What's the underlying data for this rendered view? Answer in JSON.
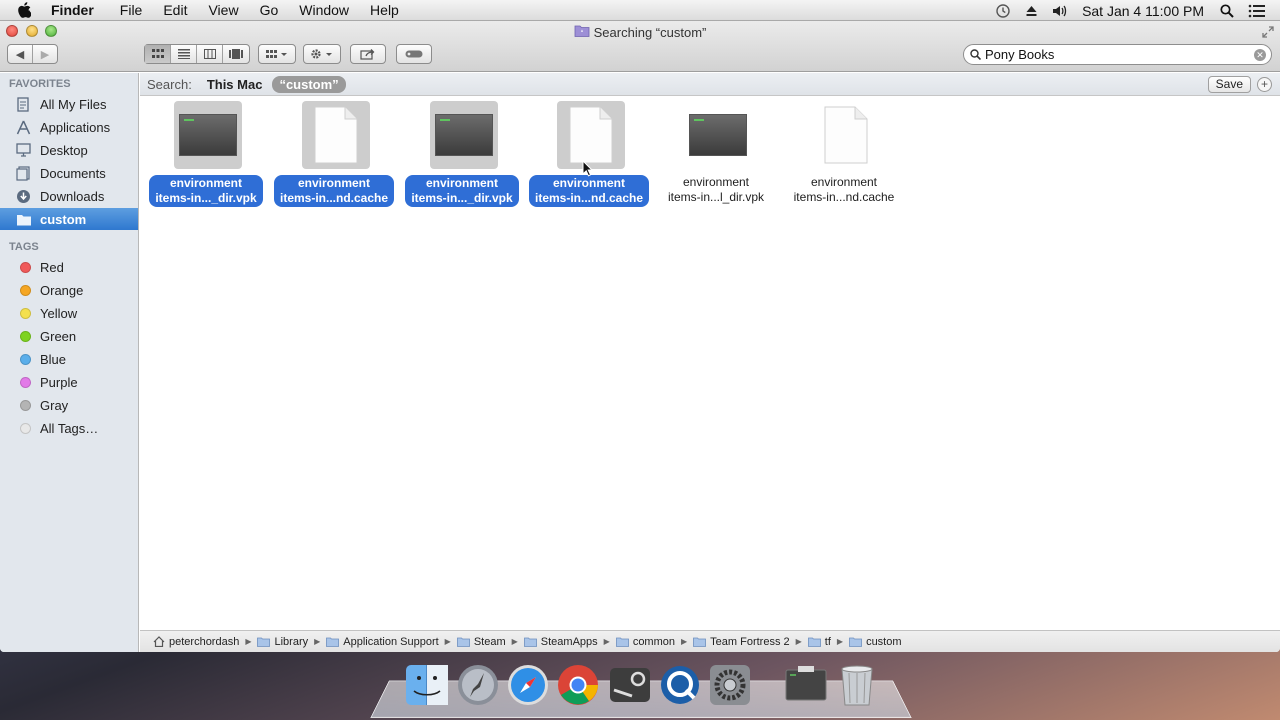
{
  "menubar": {
    "app_name": "Finder",
    "items": [
      "File",
      "Edit",
      "View",
      "Go",
      "Window",
      "Help"
    ],
    "clock": "Sat Jan 4  11:00 PM"
  },
  "window": {
    "title": "Searching “custom”",
    "search_value": "Pony Books"
  },
  "sidebar": {
    "favorites_header": "FAVORITES",
    "favorites": [
      {
        "label": "All My Files",
        "icon": "all-files-icon"
      },
      {
        "label": "Applications",
        "icon": "applications-icon"
      },
      {
        "label": "Desktop",
        "icon": "desktop-icon"
      },
      {
        "label": "Documents",
        "icon": "documents-icon"
      },
      {
        "label": "Downloads",
        "icon": "downloads-icon"
      },
      {
        "label": "custom",
        "icon": "folder-icon",
        "selected": true
      }
    ],
    "tags_header": "TAGS",
    "tags": [
      {
        "label": "Red",
        "color": "#f05a5a"
      },
      {
        "label": "Orange",
        "color": "#f5a623"
      },
      {
        "label": "Yellow",
        "color": "#f4e04d"
      },
      {
        "label": "Green",
        "color": "#7ed321"
      },
      {
        "label": "Blue",
        "color": "#5aaeea"
      },
      {
        "label": "Purple",
        "color": "#e27ae8"
      },
      {
        "label": "Gray",
        "color": "#b4b4b4"
      },
      {
        "label": "All Tags…",
        "color": "#e8e8e8"
      }
    ]
  },
  "scope": {
    "label": "Search:",
    "this_mac": "This Mac",
    "current": "“custom”",
    "save": "Save"
  },
  "files": [
    {
      "line1": "environment",
      "line2": "items-in..._dir.vpk",
      "kind": "terminal",
      "selected": true
    },
    {
      "line1": "environment",
      "line2": "items-in...nd.cache",
      "kind": "document",
      "selected": true
    },
    {
      "line1": "environment",
      "line2": "items-in..._dir.vpk",
      "kind": "terminal",
      "selected": true
    },
    {
      "line1": "environment",
      "line2": "items-in...nd.cache",
      "kind": "document",
      "selected": true
    },
    {
      "line1": "environment",
      "line2": "items-in...l_dir.vpk",
      "kind": "terminal",
      "selected": false
    },
    {
      "line1": "environment",
      "line2": "items-in...nd.cache",
      "kind": "document",
      "selected": false
    }
  ],
  "pathbar": [
    "peterchordash",
    "Library",
    "Application Support",
    "Steam",
    "SteamApps",
    "common",
    "Team Fortress 2",
    "tf",
    "custom"
  ],
  "dock": [
    "finder-icon",
    "launchpad-icon",
    "safari-icon",
    "chrome-icon",
    "steam-icon",
    "quicktime-icon",
    "system-preferences-icon",
    "terminal-icon",
    "trash-icon"
  ]
}
